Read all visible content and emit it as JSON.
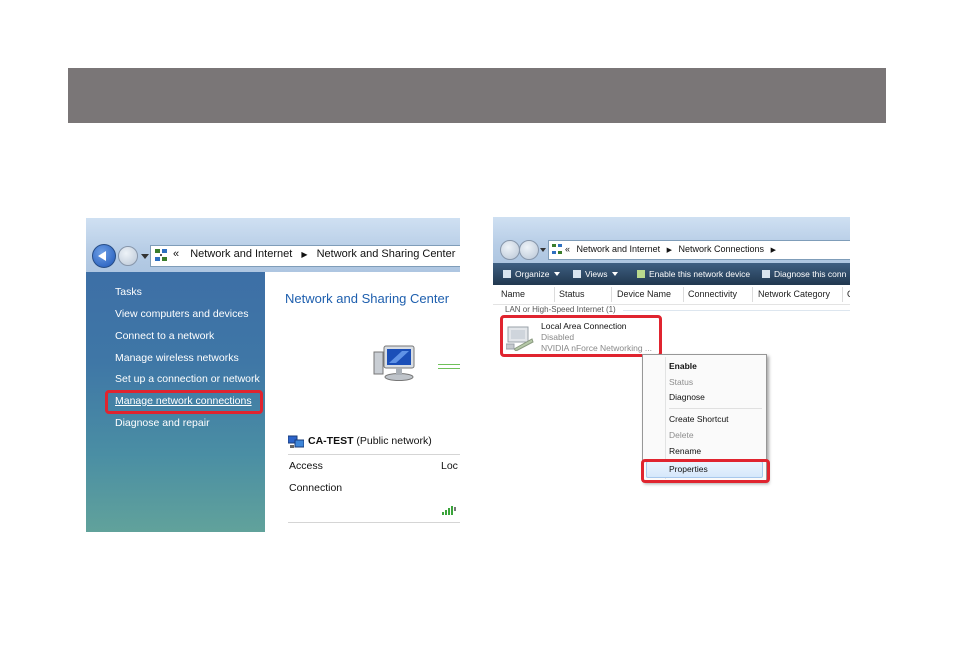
{
  "left_window": {
    "breadcrumb": {
      "prefix": "«",
      "items": [
        "Network and Internet",
        "Network and Sharing Center"
      ]
    },
    "sidebar": {
      "heading": "Tasks",
      "items": [
        "View computers and devices",
        "Connect to a network",
        "Manage wireless networks",
        "Set up a connection or network",
        "Manage network connections",
        "Diagnose and repair"
      ],
      "highlighted_item": "Manage network connections"
    },
    "content": {
      "title": "Network and Sharing Center",
      "network_name": "CA-TEST",
      "network_type": "(Public network)",
      "rows": [
        {
          "label": "Access",
          "value": "Loc"
        },
        {
          "label": "Connection",
          "value": ""
        }
      ]
    }
  },
  "right_window": {
    "breadcrumb": {
      "prefix": "«",
      "items": [
        "Network and Internet",
        "Network Connections"
      ]
    },
    "toolbar": {
      "organize": "Organize",
      "views": "Views",
      "enable": "Enable this network device",
      "diagnose": "Diagnose this conn"
    },
    "columns": [
      "Name",
      "Status",
      "Device Name",
      "Connectivity",
      "Network Category",
      "C"
    ],
    "group_label": "LAN or High-Speed Internet (1)",
    "connection": {
      "name": "Local Area Connection",
      "status": "Disabled",
      "device": "NVIDIA nForce Networking ..."
    },
    "context_menu": {
      "items": [
        {
          "label": "Enable",
          "disabled": false,
          "bold": true
        },
        {
          "label": "Status",
          "disabled": true,
          "bold": false
        },
        {
          "label": "Diagnose",
          "disabled": false,
          "bold": false
        },
        {
          "label": "Create Shortcut",
          "disabled": false,
          "bold": false
        },
        {
          "label": "Delete",
          "disabled": true,
          "bold": false
        },
        {
          "label": "Rename",
          "disabled": false,
          "bold": false
        },
        {
          "label": "Properties",
          "disabled": false,
          "bold": false
        }
      ],
      "highlighted_item": "Properties"
    }
  },
  "colors": {
    "banner": "#7a7677",
    "highlight_box": "#e0242f",
    "sidebar_top": "#3d6fa6",
    "sidebar_bottom": "#61a29b",
    "title_blue": "#1e5fae"
  }
}
